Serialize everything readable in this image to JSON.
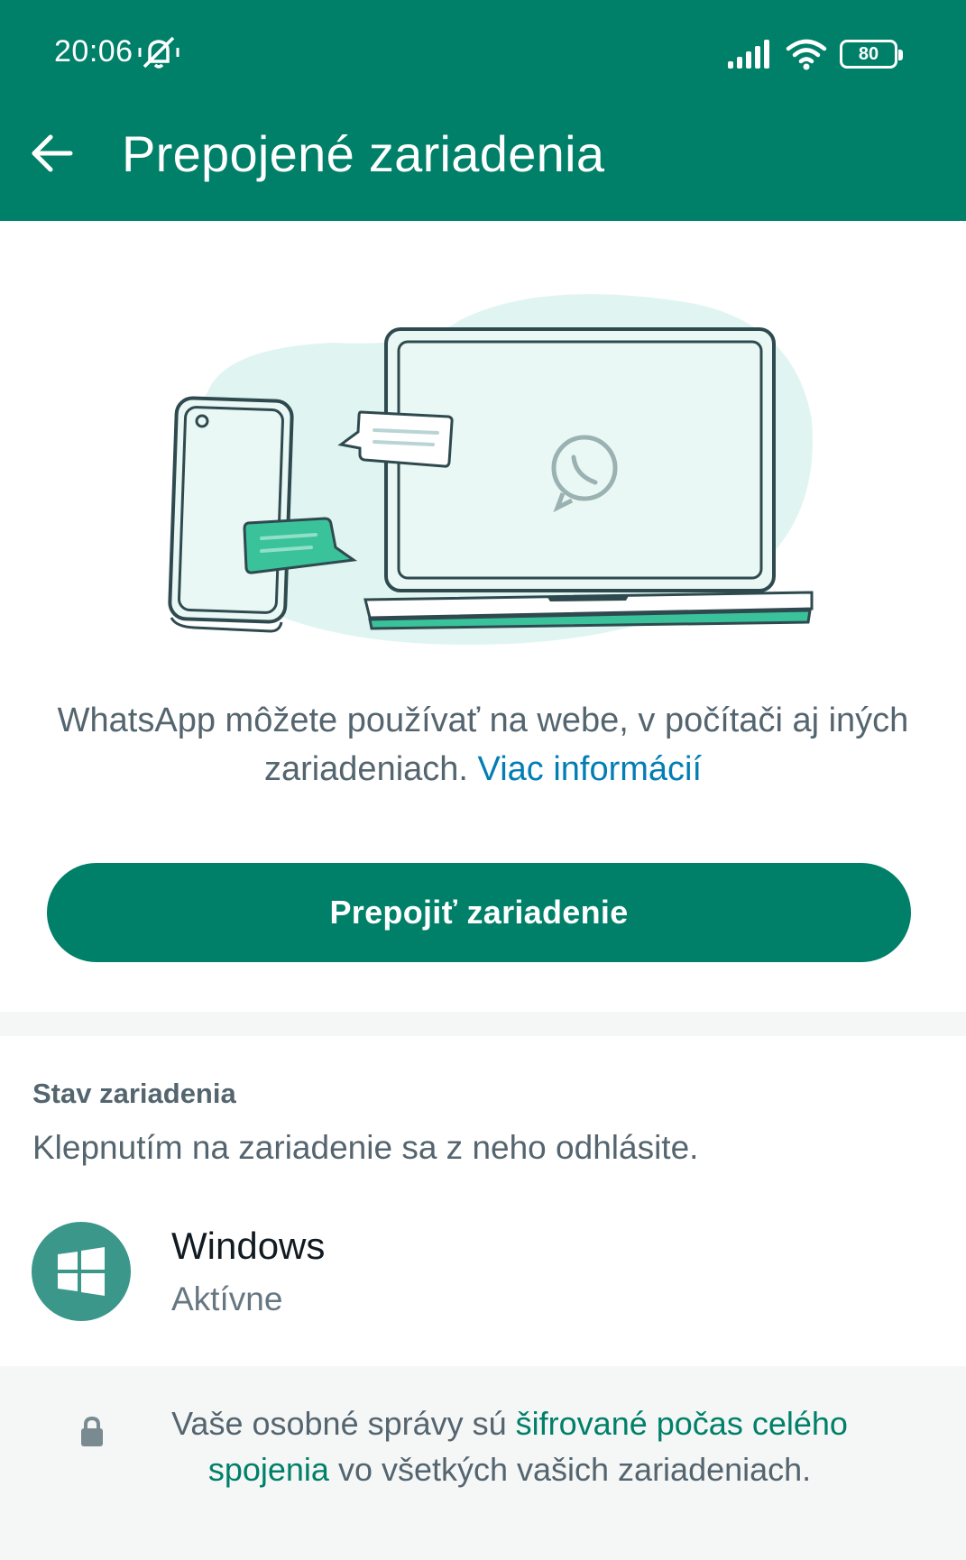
{
  "status_bar": {
    "time": "20:06",
    "battery": "80",
    "icons": [
      "muted-bell-icon",
      "signal-icon",
      "wifi-icon",
      "battery-icon"
    ]
  },
  "app_bar": {
    "title": "Prepojené zariadenia",
    "back_icon": "arrow-left-icon"
  },
  "intro": {
    "text": "WhatsApp môžete používať na webe, v počítači aj iných zariadeniach.",
    "link": "Viac informácií"
  },
  "link_button": "Prepojiť zariadenie",
  "device_section": {
    "header": "Stav zariadenia",
    "hint": "Klepnutím na zariadenie sa z neho odhlásite.",
    "devices": [
      {
        "name": "Windows",
        "status": "Aktívne",
        "icon": "windows-icon"
      }
    ]
  },
  "footer": {
    "text_before": "Vaše osobné správy sú",
    "link": "šifrované počas celého spojenia",
    "text_after": "vo všetkých vašich zariadeniach.",
    "icon": "lock-icon"
  },
  "colors": {
    "brand": "#008069",
    "link_blue": "#027eb5",
    "avatar": "#3b978a",
    "accent_green": "#25d366"
  }
}
